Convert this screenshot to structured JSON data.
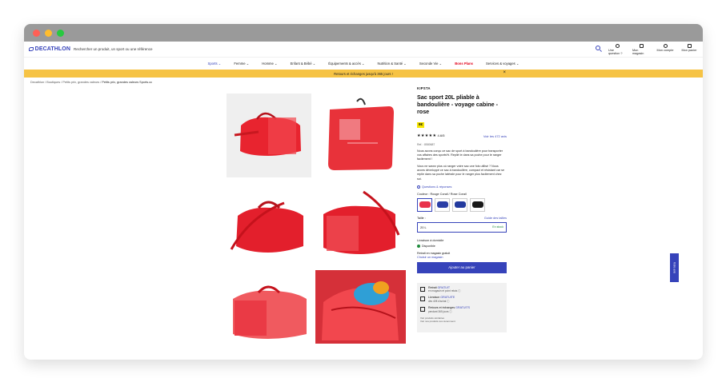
{
  "window": {
    "controls": [
      "close",
      "minimize",
      "maximize"
    ]
  },
  "header": {
    "logo": "DECATHLON",
    "search_placeholder": "Rechercher un produit, un sport ou une référence",
    "utils": [
      {
        "label": "Une question ?",
        "icon": "question-icon"
      },
      {
        "label": "Mon magasin",
        "icon": "store-icon"
      },
      {
        "label": "Mon compte",
        "icon": "user-icon"
      },
      {
        "label": "Mon panier",
        "icon": "cart-icon"
      }
    ]
  },
  "nav": {
    "items": [
      "Sports",
      "Femme",
      "Homme",
      "Enfant & Bébé",
      "Équipements & accès",
      "Nutrition & Santé",
      "Seconde Vie",
      "Bons Plans",
      "Services & voyages"
    ]
  },
  "banner": {
    "text": "Retours et échanges jusqu'à 365 jours !",
    "close": "×"
  },
  "breadcrumb": {
    "items": [
      "Decathlon",
      "Boutiques",
      "Petits prix, grandes valeurs"
    ],
    "current": "Petits prix, grandes valeurs Sports.cc"
  },
  "product": {
    "brand": "KIPSTA",
    "title": "Sac sport 20L pliable à bandoulière - voyage cabine - rose",
    "price": "8€",
    "stars": "★★★★★",
    "rating": "4.6/5",
    "reviews_link": "Voir les 472 avis",
    "ref": "Ref. : 8580687",
    "desc1": "Nous avons conçu ce sac de sport à bandoulière pour transporter vos affaires des sports%. Replié le dans sa poche pour le ranger facilement !",
    "desc2": "Vous ne savez plus où ranger votre sac une fois utilisé ? Nous avons développé ce sac à bandoulière, compact et résistant car se replie dans sa poche latérale pour le ranger plus facilement chez soi.",
    "qa_link": "Questions & réponses",
    "color_label": "Couleur : Rouge Corail / Rose Corail",
    "colors": [
      "#e8324a",
      "#2b3fa6",
      "#233a9e",
      "#1a1a1a"
    ],
    "size_label": "Taille :",
    "size_guide": "Guide des tailles",
    "size_value": "20 L",
    "size_stock": "En stock",
    "delivery_label": "Livraison à domicile",
    "availability": "Disponible",
    "store_label": "Retrait en magasin gratuit",
    "store_link": "Choisir un magasin",
    "add_to_cart": "Ajouter au panier"
  },
  "services": [
    {
      "title": "Retrait",
      "highlight": "GRATUIT",
      "sub": "en magasin et point relais ⓘ"
    },
    {
      "title": "Livraison",
      "highlight": "GRATUITE",
      "sub": "dès 40€ d'achat ⓘ"
    },
    {
      "title": "Retours et échanges",
      "highlight": "GRATUITS",
      "sub": "pendant 365 jours ⓘ"
    }
  ],
  "fine_print": [
    "Voir produits similaires",
    "Voir nos produits vus récemment"
  ],
  "side_tab": "Votre avis"
}
